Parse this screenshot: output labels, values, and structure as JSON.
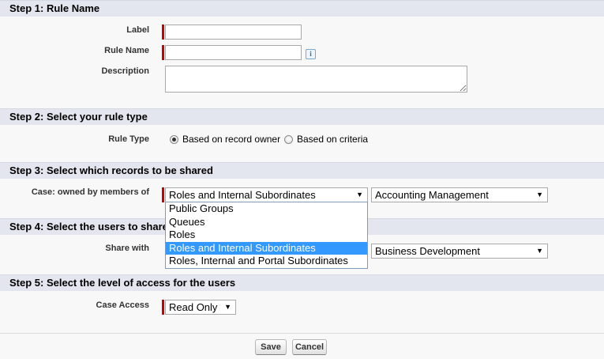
{
  "step1": {
    "title": "Step 1: Rule Name",
    "label_label": "Label",
    "label_value": "",
    "rule_name_label": "Rule Name",
    "rule_name_value": "",
    "description_label": "Description",
    "description_value": ""
  },
  "step2": {
    "title": "Step 2: Select your rule type",
    "rule_type_label": "Rule Type",
    "option_owner": "Based on record owner",
    "option_criteria": "Based on criteria",
    "selected": "Based on record owner"
  },
  "step3": {
    "title": "Step 3: Select which records to be shared",
    "owned_by_label": "Case: owned by members of",
    "owner_type_value": "Roles and Internal Subordinates",
    "owner_value": "Accounting Management",
    "dropdown_options": [
      "Public Groups",
      "Queues",
      "Roles",
      "Roles and Internal Subordinates",
      "Roles, Internal and Portal Subordinates"
    ]
  },
  "step4": {
    "title": "Step 4: Select the users to share",
    "share_with_label": "Share with",
    "share_with_value": "Business Development"
  },
  "step5": {
    "title": "Step 5: Select the level of access for the users",
    "case_access_label": "Case Access",
    "case_access_value": "Read Only"
  },
  "buttons": {
    "save": "Save",
    "cancel": "Cancel"
  },
  "colors": {
    "section_bg": "#e3e6ee",
    "required_bar": "#cc0000",
    "selected_option": "#3399ff"
  }
}
